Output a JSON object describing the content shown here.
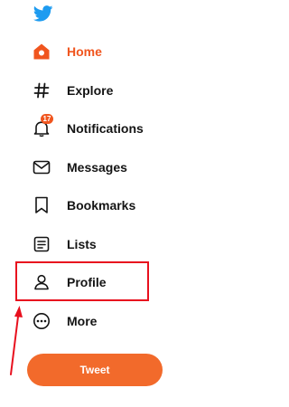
{
  "app": {
    "logo_icon": "twitter-bird-icon",
    "accent_color": "#f0551e",
    "logo_color": "#1d9bf0"
  },
  "nav": {
    "items": [
      {
        "label": "Home",
        "icon": "home-icon",
        "active": true
      },
      {
        "label": "Explore",
        "icon": "hashtag-icon",
        "active": false
      },
      {
        "label": "Notifications",
        "icon": "bell-icon",
        "active": false,
        "badge": "17"
      },
      {
        "label": "Messages",
        "icon": "envelope-icon",
        "active": false
      },
      {
        "label": "Bookmarks",
        "icon": "bookmark-icon",
        "active": false
      },
      {
        "label": "Lists",
        "icon": "list-icon",
        "active": false
      },
      {
        "label": "Profile",
        "icon": "person-icon",
        "active": false
      },
      {
        "label": "More",
        "icon": "more-circle-icon",
        "active": false
      }
    ]
  },
  "tweet_button": {
    "label": "Tweet"
  },
  "annotation": {
    "highlight_color": "#e8101e",
    "highlighted_item": "Profile"
  }
}
